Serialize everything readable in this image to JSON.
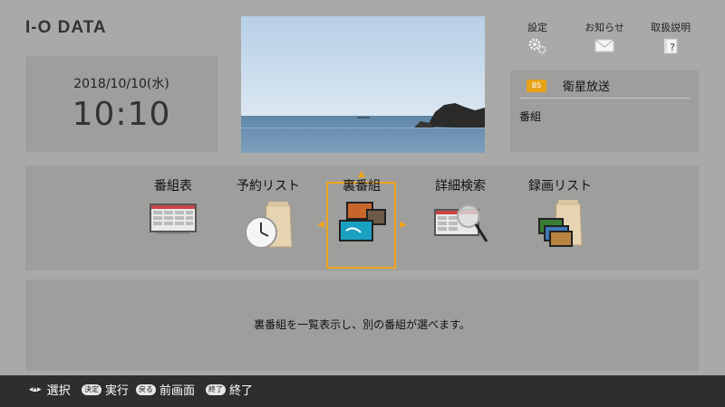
{
  "brand": "I-O DATA",
  "clock": {
    "date": "2018/10/10(水)",
    "time": "10:10"
  },
  "top_buttons": [
    {
      "id": "settings",
      "label": "設定",
      "icon": "gear-icon"
    },
    {
      "id": "news",
      "label": "お知らせ",
      "icon": "envelope-icon"
    },
    {
      "id": "manual",
      "label": "取扱説明",
      "icon": "help-book-icon"
    }
  ],
  "channel": {
    "badge": "BS",
    "name": "衛星放送",
    "program": "番組"
  },
  "menu": {
    "items": [
      {
        "id": "program-guide",
        "label": "番組表",
        "icon": "program-guide-icon"
      },
      {
        "id": "reservation-list",
        "label": "予約リスト",
        "icon": "clock-bag-icon"
      },
      {
        "id": "other-programs",
        "label": "裏番組",
        "icon": "photos-icon",
        "selected": true
      },
      {
        "id": "detailed-search",
        "label": "詳細検索",
        "icon": "magnifier-icon"
      },
      {
        "id": "recording-list",
        "label": "録画リスト",
        "icon": "recordings-bag-icon"
      }
    ]
  },
  "description": "裏番組を一覧表示し、別の番組が選べます。",
  "footer": [
    {
      "key": "",
      "label": "選択"
    },
    {
      "key": "決定",
      "label": "実行"
    },
    {
      "key": "戻る",
      "label": "前画面"
    },
    {
      "key": "終了",
      "label": "終了"
    }
  ],
  "colors": {
    "background": "#a9aaa8",
    "panel": "#9e9f9d",
    "accent": "#f0a31c",
    "footer": "#2d2e2d"
  }
}
